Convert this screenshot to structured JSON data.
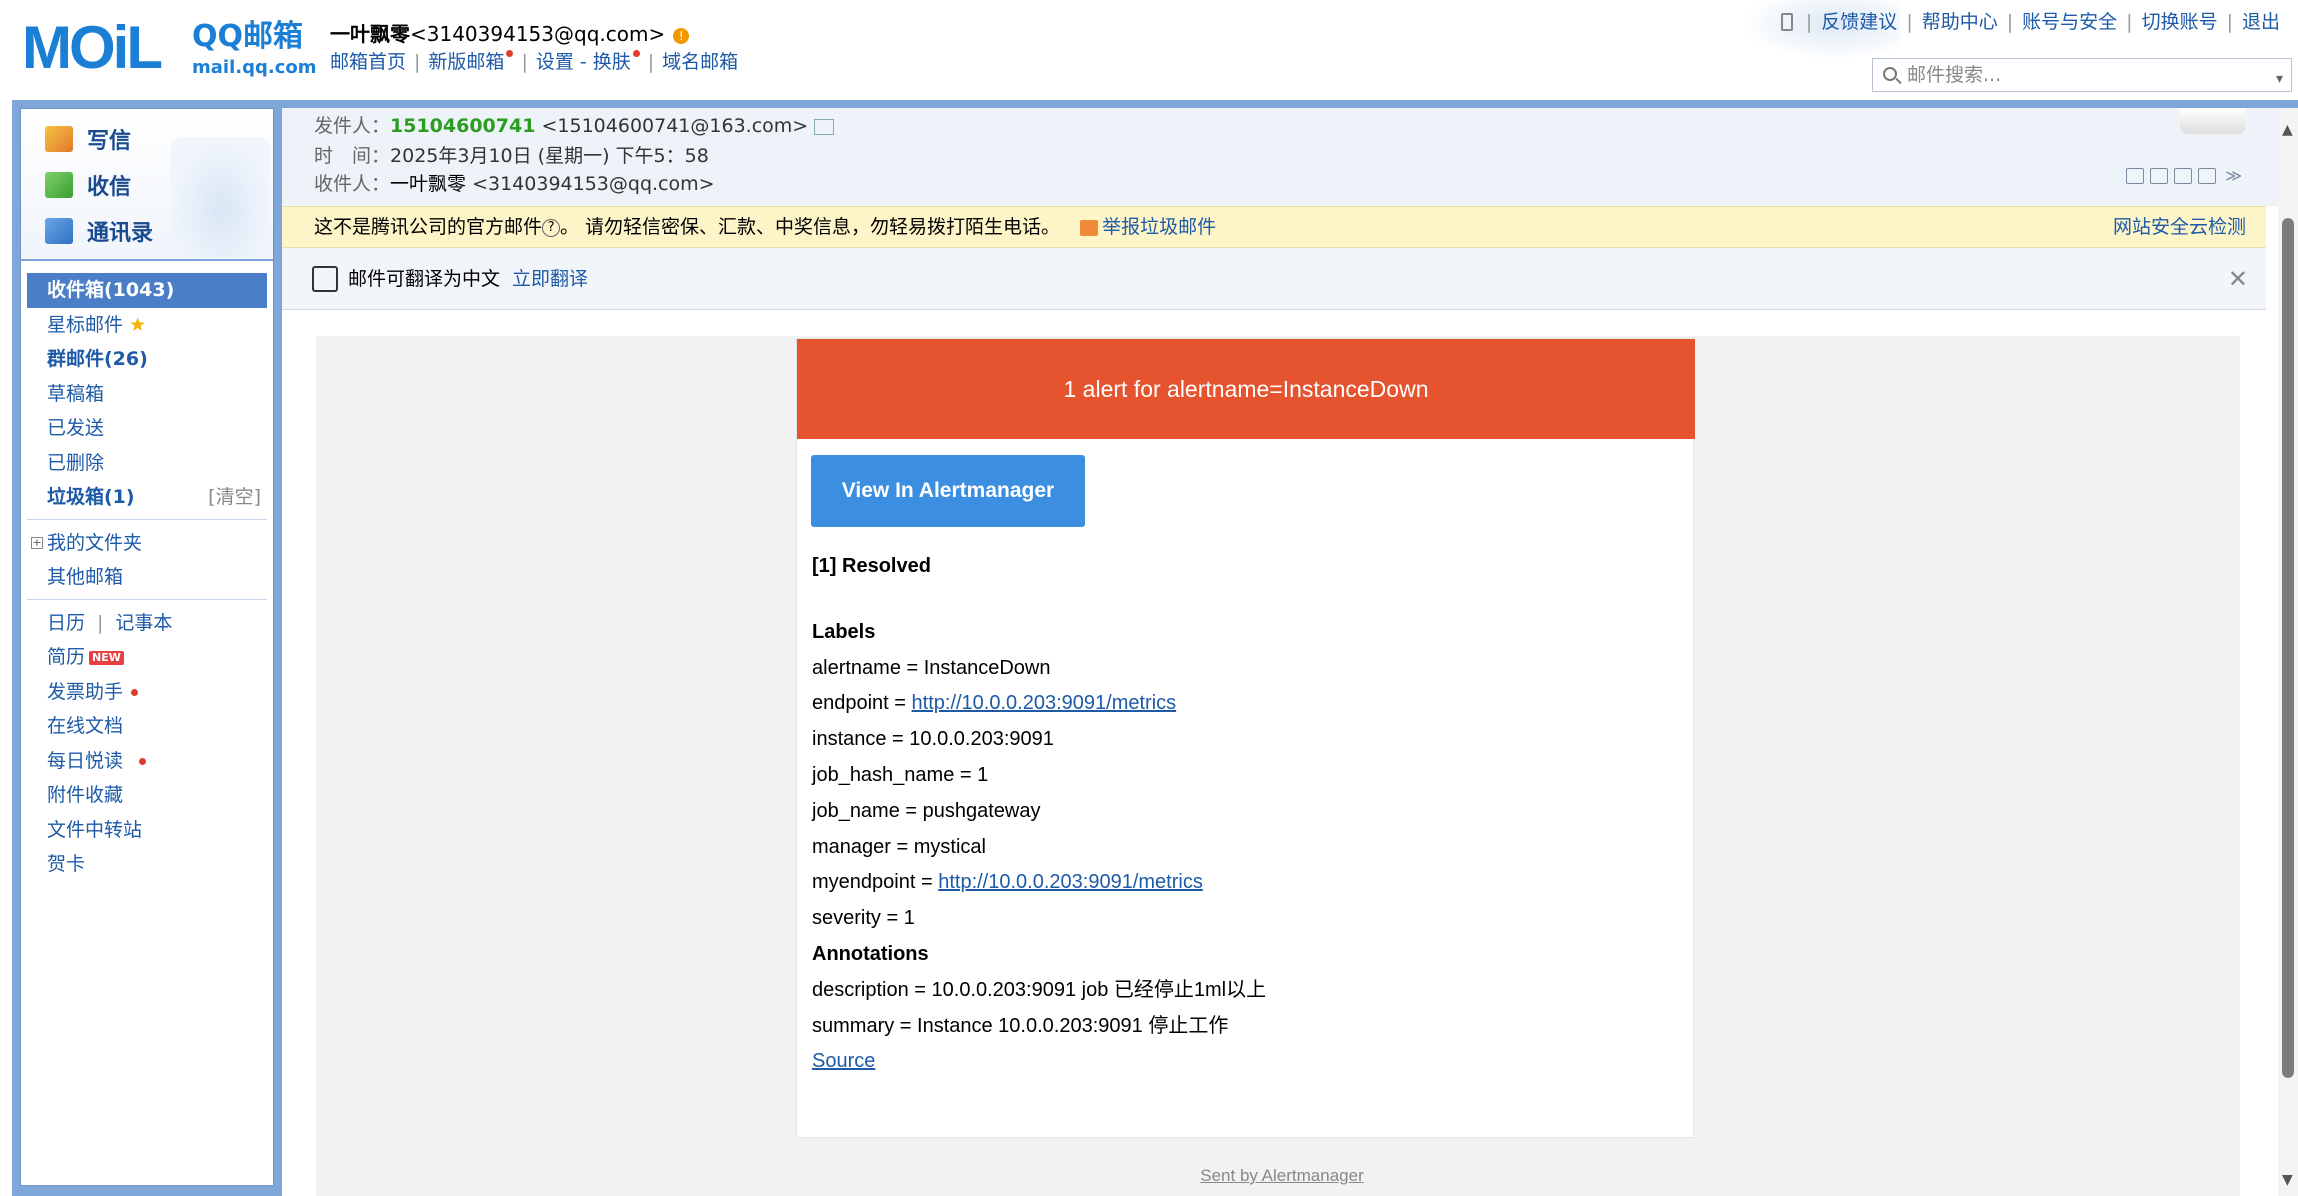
{
  "logo": {
    "mo": "MOiL",
    "qq": "QQ邮箱",
    "sub": "mail.qq.com"
  },
  "user": {
    "name": "一叶飘零",
    "email": "<3140394153@qq.com>",
    "warn": "!"
  },
  "top_links": [
    "邮箱首页",
    "新版邮箱",
    "设置",
    "换肤",
    "域名邮箱"
  ],
  "top_sep": "|",
  "top_dash": "-",
  "right_links": [
    "反馈建议",
    "帮助中心",
    "账号与安全",
    "切换账号",
    "退出"
  ],
  "search": {
    "placeholder": "邮件搜索...",
    "dropdown": "▾"
  },
  "nav_big": [
    "写信",
    "收信",
    "通讯录"
  ],
  "folders": {
    "inbox": "收件箱(1043)",
    "starred": "星标邮件",
    "star": "★",
    "group": "群邮件(26)",
    "drafts": "草稿箱",
    "sent": "已发送",
    "deleted": "已删除",
    "spam": "垃圾箱(1)",
    "spam_clear": "[清空]",
    "my_folders_toggle": "+",
    "my_folders": "我的文件夹",
    "other": "其他邮箱",
    "calendar": "日历",
    "notes": "记事本",
    "resume": "简历",
    "new_badge": "NEW",
    "invoice": "发票助手",
    "docs": "在线文档",
    "daily": "每日悦读",
    "attachments": "附件收藏",
    "transfer": "文件中转站",
    "cards": "贺卡"
  },
  "header": {
    "from_label": "发件人：",
    "from_name": "15104600741",
    "from_email": "<15104600741@163.com>",
    "time_label": "时　间：",
    "time_value": "2025年3月10日 (星期一) 下午5：58",
    "to_label": "收件人：",
    "to_name": "一叶飘零",
    "to_email": "<3140394153@qq.com>",
    "chevron": "≫"
  },
  "warning": {
    "text1": "这不是腾讯公司的官方邮件",
    "q": "?",
    "text2": "。 请勿轻信密保、汇款、中奖信息，勿轻易拨打陌生电话。",
    "report": "举报垃圾邮件",
    "right": "网站安全云检测"
  },
  "translate": {
    "text": "邮件可翻译为中文",
    "link": "立即翻译",
    "close": "✕"
  },
  "email": {
    "header": "1 alert for alertname=InstanceDown",
    "button": "View In Alertmanager",
    "resolved": "[1] Resolved",
    "labels_title": "Labels",
    "l1": "alertname = InstanceDown",
    "l2_key": "endpoint = ",
    "l2_link": "http://10.0.0.203:9091/metrics",
    "l3": "instance = 10.0.0.203:9091",
    "l4": "job_hash_name = 1",
    "l5": "job_name = pushgateway",
    "l6": "manager = mystical",
    "l7_key": "myendpoint = ",
    "l7_link": "http://10.0.0.203:9091/metrics",
    "l8": "severity = 1",
    "annotations_title": "Annotations",
    "a1": "description = 10.0.0.203:9091 job 已经停止1ml以上",
    "a2": "summary = Instance 10.0.0.203:9091 停止工作",
    "source": "Source",
    "sent_by": "Sent by Alertmanager"
  },
  "scroll": {
    "up": "▲",
    "down": "▼"
  }
}
